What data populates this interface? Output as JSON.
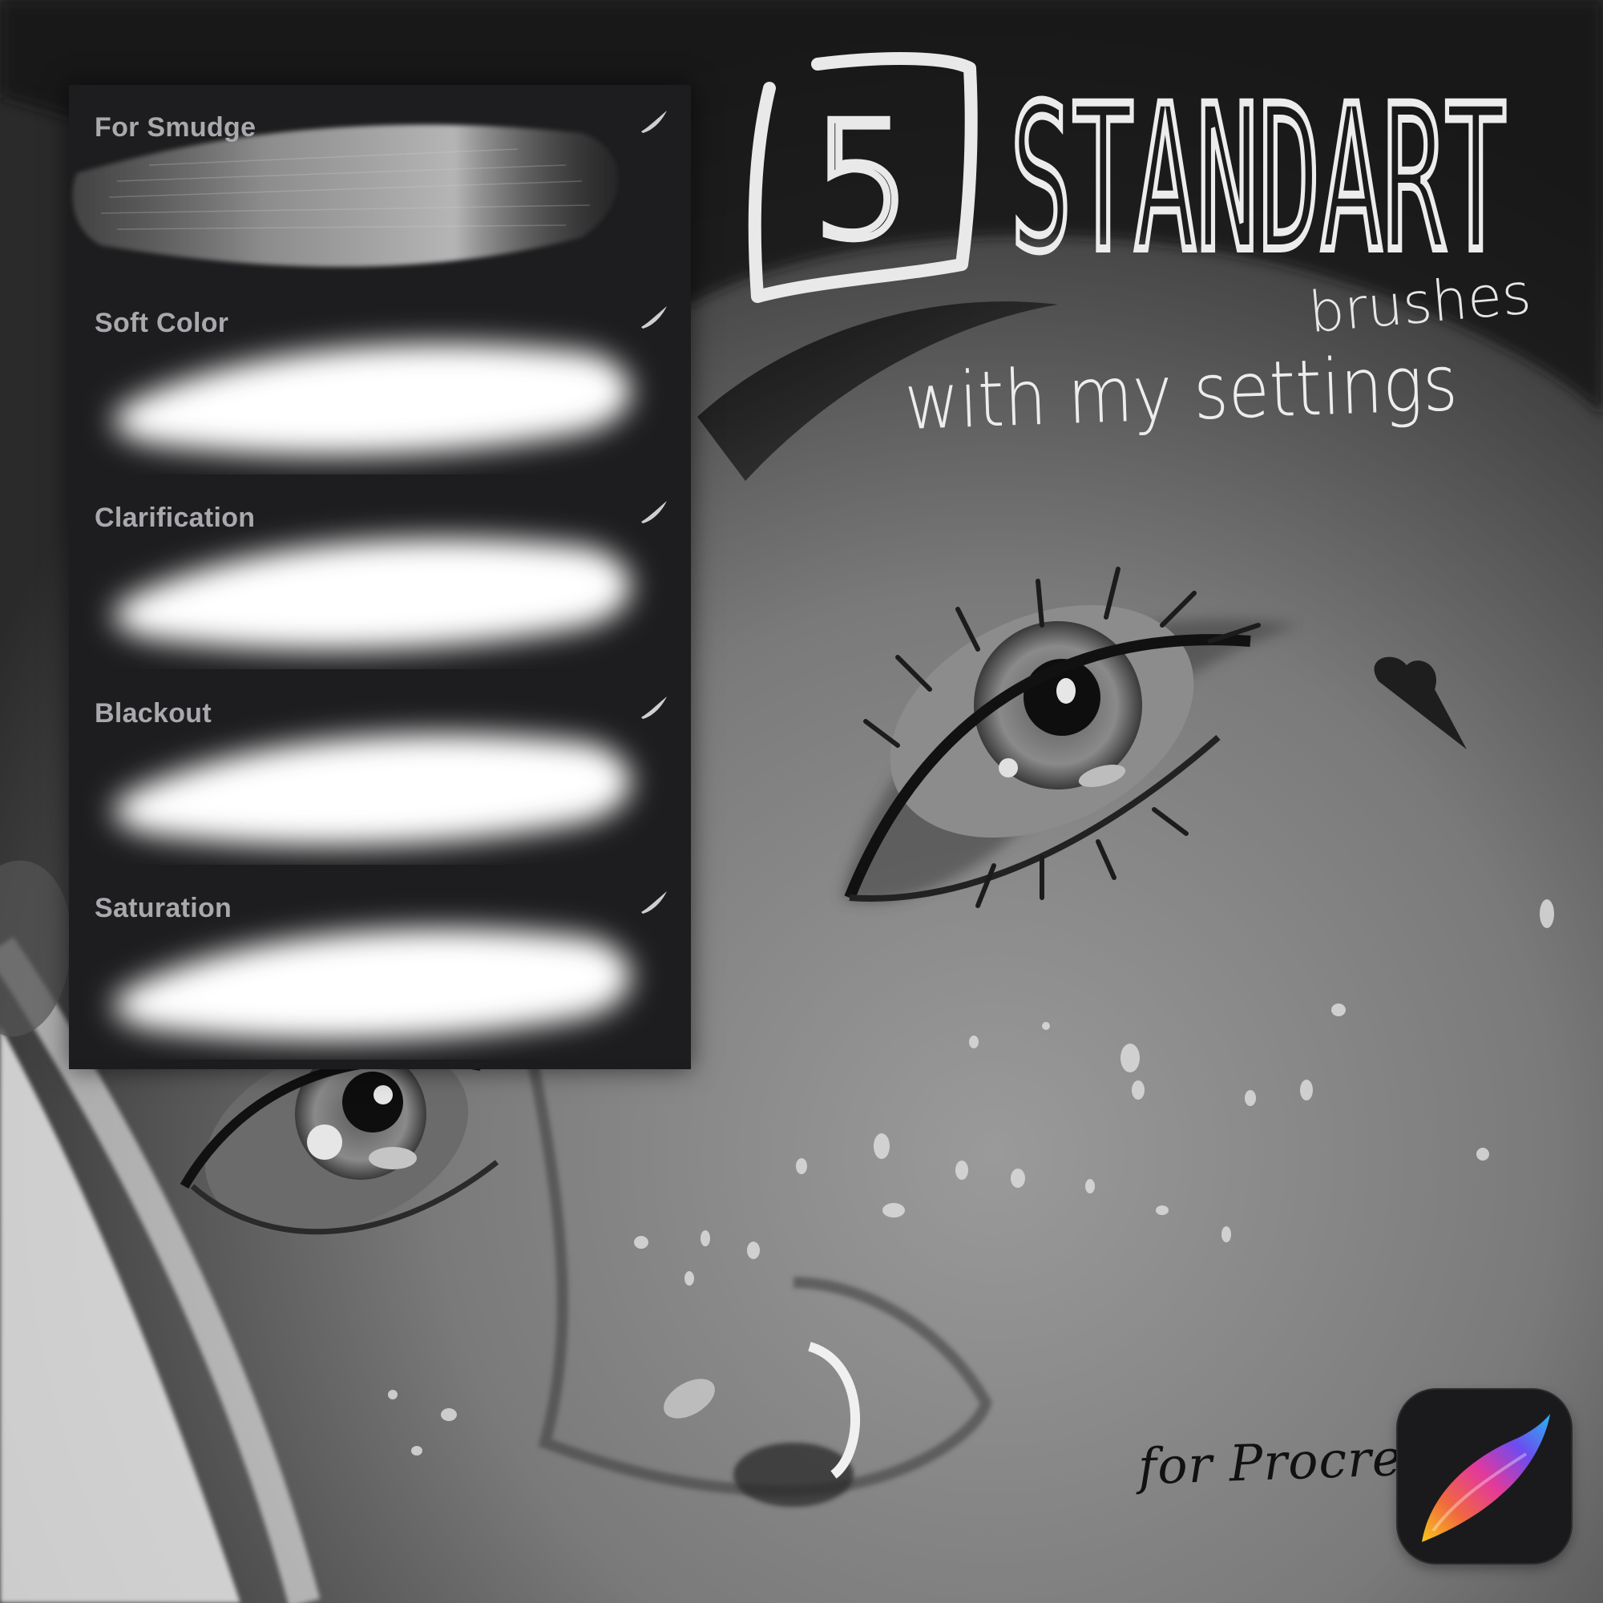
{
  "title": {
    "count": "5",
    "headline": "STANDART",
    "sub": "brushes",
    "tagline": "with my settings"
  },
  "brushes": [
    {
      "name": "For Smudge",
      "style": "textured"
    },
    {
      "name": "Soft Color",
      "style": "soft"
    },
    {
      "name": "Clarification",
      "style": "soft"
    },
    {
      "name": "Blackout",
      "style": "soft"
    },
    {
      "name": "Saturation",
      "style": "soft"
    }
  ],
  "footer": {
    "label": "for Procreate",
    "app_icon": "procreate-brush-icon"
  }
}
